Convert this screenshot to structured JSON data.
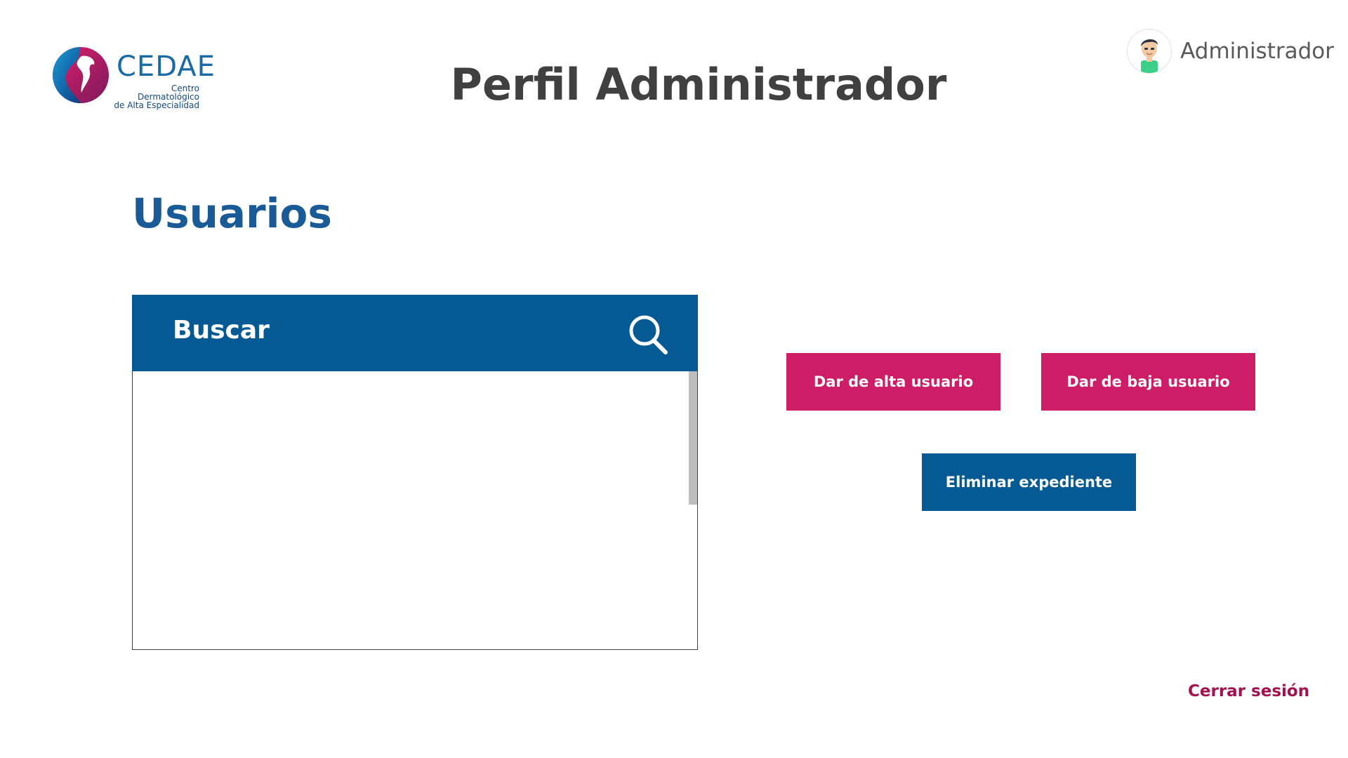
{
  "header": {
    "logo": {
      "name": "CEDAE",
      "subtitle_line1": "Centro Dermatológico",
      "subtitle_line2": "de Alta Especialidad"
    },
    "title": "Perfil Administrador",
    "user": {
      "name": "Administrador",
      "avatar_icon": "user-avatar-icon"
    }
  },
  "main": {
    "section_title": "Usuarios",
    "search": {
      "label": "Buscar",
      "icon": "search-icon",
      "results": []
    },
    "actions": {
      "alta_label": "Dar de alta usuario",
      "baja_label": "Dar de baja usuario",
      "eliminar_label": "Eliminar expediente"
    }
  },
  "footer": {
    "logout_label": "Cerrar sesión"
  },
  "colors": {
    "primary_blue": "#065a93",
    "accent_pink": "#cc1d66",
    "logout_text": "#a3124f",
    "title_text": "#404040"
  }
}
